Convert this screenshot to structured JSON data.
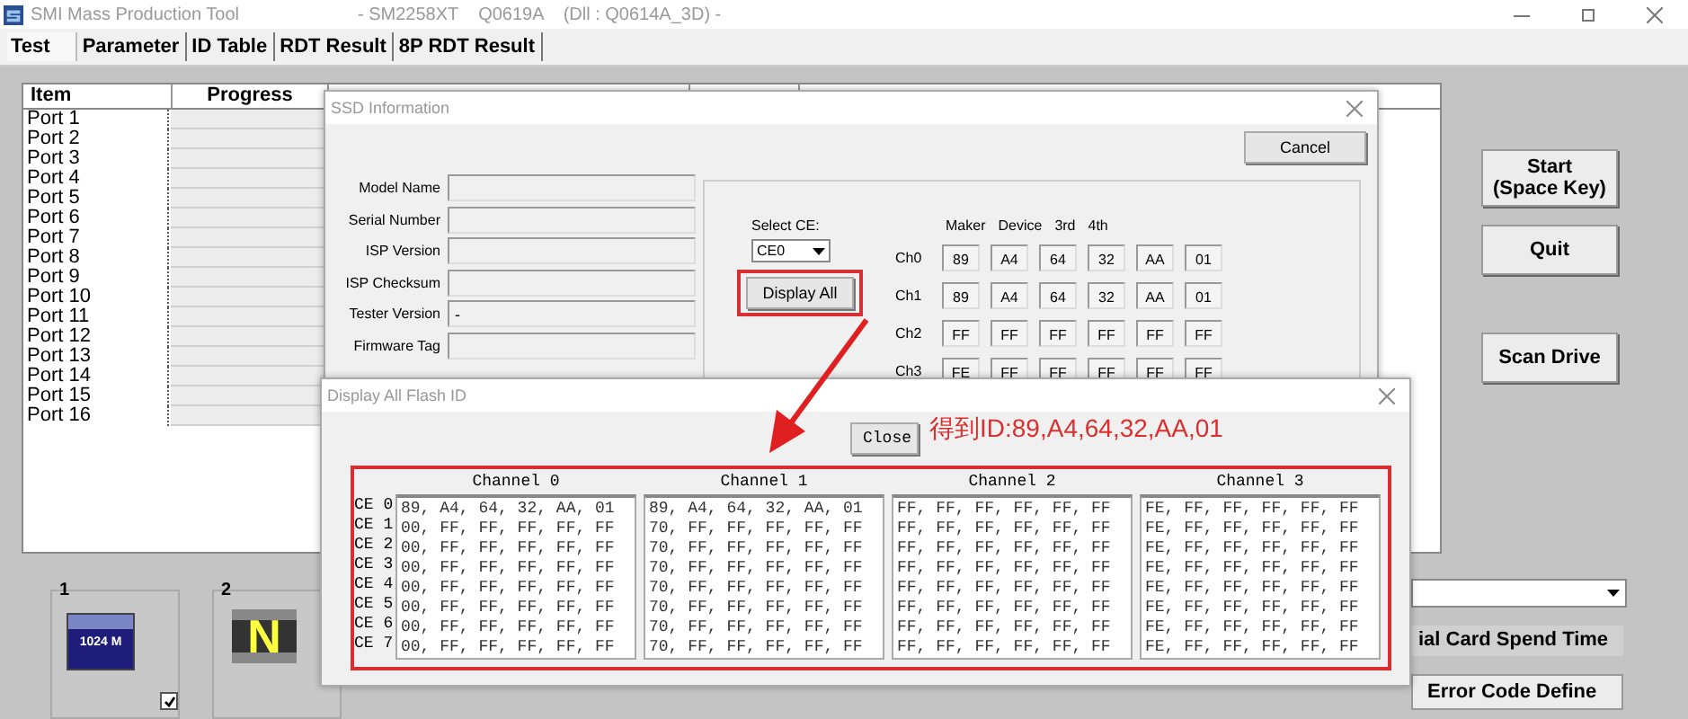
{
  "window": {
    "title": "SMI Mass Production Tool",
    "subtitle": "- SM2258XT    Q0619A    (Dll : Q0614A_3D) -"
  },
  "tabs": [
    {
      "label": "Test",
      "selected": true
    },
    {
      "label": "Parameter",
      "selected": false
    },
    {
      "label": "ID Table",
      "selected": false
    },
    {
      "label": "RDT Result",
      "selected": false
    },
    {
      "label": "8P RDT Result",
      "selected": false
    }
  ],
  "port_table": {
    "columns": [
      "Item",
      "Progress"
    ],
    "rows": [
      {
        "label": "Port 1",
        "level": 0
      },
      {
        "label": "Port 2",
        "level": 0
      },
      {
        "label": "Port 3",
        "level": 0
      },
      {
        "label": "Port 4",
        "level": 0
      },
      {
        "label": "Port 5",
        "level": 0
      },
      {
        "label": "Port 6",
        "level": 0
      },
      {
        "label": "Port 7",
        "level": 0
      },
      {
        "label": "Port 8",
        "level": 0
      },
      {
        "label": "Port 9",
        "level": 0
      },
      {
        "label": "Port 10",
        "level": 0
      },
      {
        "label": "Port 11",
        "level": 0
      },
      {
        "label": "Port 12",
        "level": 0
      },
      {
        "label": "Port 13",
        "level": 0
      },
      {
        "label": "Port 14",
        "level": 0
      },
      {
        "label": "Port 15",
        "level": 0
      },
      {
        "label": "Port 16",
        "level": 0
      }
    ]
  },
  "slots": [
    {
      "number": "1",
      "kind": "capacity",
      "badge": "1024 M",
      "checked": true
    },
    {
      "number": "2",
      "kind": "letter",
      "badge": "N"
    }
  ],
  "side_buttons": [
    {
      "lines": [
        "Start",
        "(Space Key)"
      ]
    },
    {
      "lines": [
        "Quit"
      ]
    },
    {
      "lines": [
        "Scan Drive"
      ]
    }
  ],
  "spend_time_label": "ial Card Spend Time",
  "error_button": "Error Code Define",
  "ssd_dialog": {
    "title": "SSD Information",
    "cancel": "Cancel",
    "fields": [
      {
        "label": "Model Name"
      },
      {
        "label": "Serial Number"
      },
      {
        "label": "ISP Version"
      },
      {
        "label": "ISP Checksum"
      },
      {
        "label": "Tester Version",
        "value": "-"
      },
      {
        "label": "Firmware Tag"
      }
    ],
    "select_ce": {
      "label": "Select CE:",
      "value": "CE0"
    },
    "display_all": "Display All",
    "id_columns": [
      "Maker",
      "Device",
      "3rd",
      "4th"
    ],
    "channels": [
      {
        "label": "Ch0",
        "values": [
          "89",
          "A4",
          "64",
          "32",
          "AA",
          "01"
        ]
      },
      {
        "label": "Ch1",
        "values": [
          "89",
          "A4",
          "64",
          "32",
          "AA",
          "01"
        ]
      },
      {
        "label": "Ch2",
        "values": [
          "FF",
          "FF",
          "FF",
          "FF",
          "FF",
          "FF"
        ]
      },
      {
        "label": "Ch3",
        "values": [
          "FE",
          "FF",
          "FF",
          "FF",
          "FF",
          "FF"
        ]
      }
    ]
  },
  "flash_dialog": {
    "title": "Display All Flash ID",
    "close": "Close",
    "annotation": "得到ID:89,A4,64,32,AA,01",
    "ce_labels": [
      "CE 0",
      "CE 1",
      "CE 2",
      "CE 3",
      "CE 4",
      "CE 5",
      "CE 6",
      "CE 7"
    ],
    "channels": [
      {
        "title": "Channel 0",
        "rows": [
          "89, A4, 64, 32, AA, 01",
          "00, FF, FF, FF, FF, FF",
          "00, FF, FF, FF, FF, FF",
          "00, FF, FF, FF, FF, FF",
          "00, FF, FF, FF, FF, FF",
          "00, FF, FF, FF, FF, FF",
          "00, FF, FF, FF, FF, FF",
          "00, FF, FF, FF, FF, FF"
        ]
      },
      {
        "title": "Channel 1",
        "rows": [
          "89, A4, 64, 32, AA, 01",
          "70, FF, FF, FF, FF, FF",
          "70, FF, FF, FF, FF, FF",
          "70, FF, FF, FF, FF, FF",
          "70, FF, FF, FF, FF, FF",
          "70, FF, FF, FF, FF, FF",
          "70, FF, FF, FF, FF, FF",
          "70, FF, FF, FF, FF, FF"
        ]
      },
      {
        "title": "Channel 2",
        "rows": [
          "FF, FF, FF, FF, FF, FF",
          "FF, FF, FF, FF, FF, FF",
          "FF, FF, FF, FF, FF, FF",
          "FF, FF, FF, FF, FF, FF",
          "FF, FF, FF, FF, FF, FF",
          "FF, FF, FF, FF, FF, FF",
          "FF, FF, FF, FF, FF, FF",
          "FF, FF, FF, FF, FF, FF"
        ]
      },
      {
        "title": "Channel 3",
        "rows": [
          "FE, FF, FF, FF, FF, FF",
          "FE, FF, FF, FF, FF, FF",
          "FE, FF, FF, FF, FF, FF",
          "FE, FF, FF, FF, FF, FF",
          "FE, FF, FF, FF, FF, FF",
          "FE, FF, FF, FF, FF, FF",
          "FE, FF, FF, FF, FF, FF",
          "FE, FF, FF, FF, FF, FF"
        ]
      }
    ]
  }
}
